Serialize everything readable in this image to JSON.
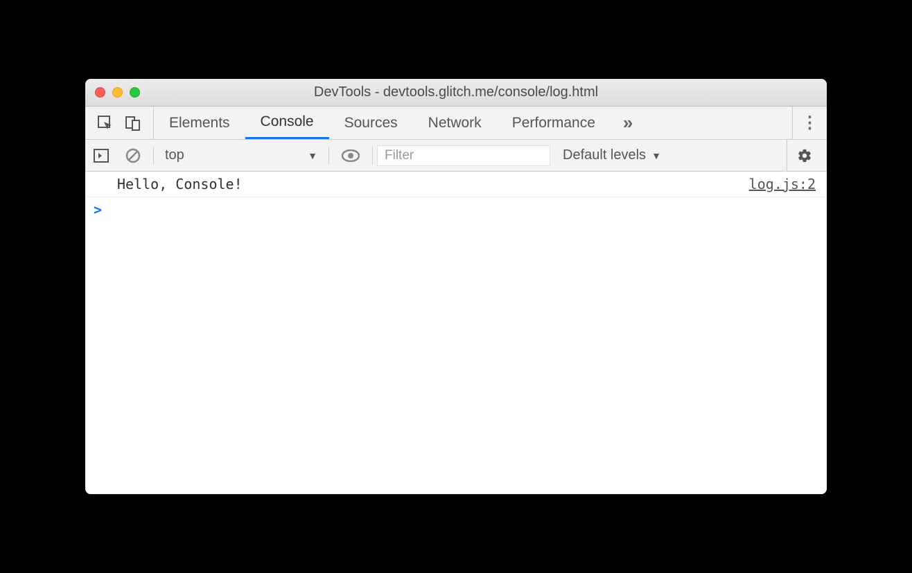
{
  "window": {
    "title": "DevTools - devtools.glitch.me/console/log.html"
  },
  "tabs": {
    "elements": "Elements",
    "console": "Console",
    "sources": "Sources",
    "network": "Network",
    "performance": "Performance"
  },
  "toolbar": {
    "context": "top",
    "filter_placeholder": "Filter",
    "levels_label": "Default levels"
  },
  "log": {
    "message": "Hello, Console!",
    "source": "log.js:2"
  },
  "prompt": ">"
}
